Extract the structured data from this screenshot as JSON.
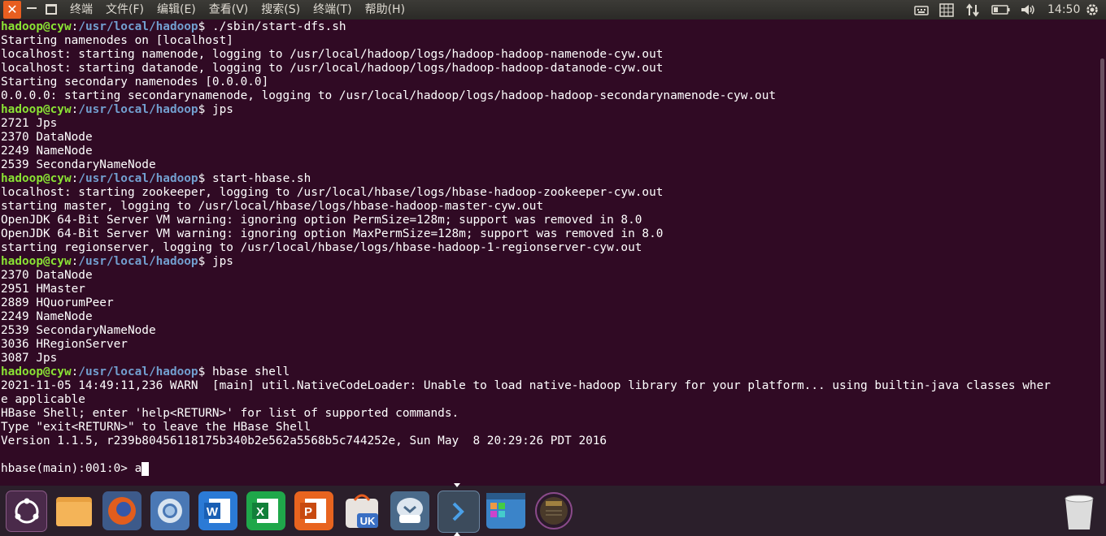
{
  "menubar": {
    "items": [
      "终端",
      "文件(F)",
      "编辑(E)",
      "查看(V)",
      "搜索(S)",
      "终端(T)",
      "帮助(H)"
    ],
    "clock": "14:50"
  },
  "prompt": {
    "user": "hadoop@cyw",
    "path": "/usr/local/hadoop",
    "suffix": "$ "
  },
  "terminal_lines": [
    {
      "type": "prompt",
      "cmd": "./sbin/start-dfs.sh"
    },
    {
      "type": "out",
      "text": "Starting namenodes on [localhost]"
    },
    {
      "type": "out",
      "text": "localhost: starting namenode, logging to /usr/local/hadoop/logs/hadoop-hadoop-namenode-cyw.out"
    },
    {
      "type": "out",
      "text": "localhost: starting datanode, logging to /usr/local/hadoop/logs/hadoop-hadoop-datanode-cyw.out"
    },
    {
      "type": "out",
      "text": "Starting secondary namenodes [0.0.0.0]"
    },
    {
      "type": "out",
      "text": "0.0.0.0: starting secondarynamenode, logging to /usr/local/hadoop/logs/hadoop-hadoop-secondarynamenode-cyw.out"
    },
    {
      "type": "prompt",
      "cmd": "jps"
    },
    {
      "type": "out",
      "text": "2721 Jps"
    },
    {
      "type": "out",
      "text": "2370 DataNode"
    },
    {
      "type": "out",
      "text": "2249 NameNode"
    },
    {
      "type": "out",
      "text": "2539 SecondaryNameNode"
    },
    {
      "type": "prompt",
      "cmd": "start-hbase.sh"
    },
    {
      "type": "out",
      "text": "localhost: starting zookeeper, logging to /usr/local/hbase/logs/hbase-hadoop-zookeeper-cyw.out"
    },
    {
      "type": "out",
      "text": "starting master, logging to /usr/local/hbase/logs/hbase-hadoop-master-cyw.out"
    },
    {
      "type": "out",
      "text": "OpenJDK 64-Bit Server VM warning: ignoring option PermSize=128m; support was removed in 8.0"
    },
    {
      "type": "out",
      "text": "OpenJDK 64-Bit Server VM warning: ignoring option MaxPermSize=128m; support was removed in 8.0"
    },
    {
      "type": "out",
      "text": "starting regionserver, logging to /usr/local/hbase/logs/hbase-hadoop-1-regionserver-cyw.out"
    },
    {
      "type": "prompt",
      "cmd": "jps"
    },
    {
      "type": "out",
      "text": "2370 DataNode"
    },
    {
      "type": "out",
      "text": "2951 HMaster"
    },
    {
      "type": "out",
      "text": "2889 HQuorumPeer"
    },
    {
      "type": "out",
      "text": "2249 NameNode"
    },
    {
      "type": "out",
      "text": "2539 SecondaryNameNode"
    },
    {
      "type": "out",
      "text": "3036 HRegionServer"
    },
    {
      "type": "out",
      "text": "3087 Jps"
    },
    {
      "type": "prompt",
      "cmd": "hbase shell"
    },
    {
      "type": "out",
      "text": "2021-11-05 14:49:11,236 WARN  [main] util.NativeCodeLoader: Unable to load native-hadoop library for your platform... using builtin-java classes wher"
    },
    {
      "type": "out",
      "text": "e applicable"
    },
    {
      "type": "out",
      "text": "HBase Shell; enter 'help<RETURN>' for list of supported commands."
    },
    {
      "type": "out",
      "text": "Type \"exit<RETURN>\" to leave the HBase Shell"
    },
    {
      "type": "out",
      "text": "Version 1.1.5, r239b80456118175b340b2e562a5568b5c744252e, Sun May  8 20:29:26 PDT 2016"
    },
    {
      "type": "out",
      "text": ""
    },
    {
      "type": "hbase",
      "text": "hbase(main):001:0> ",
      "input": "a"
    }
  ],
  "dock": {
    "items": [
      {
        "icon": "ubuntu-dash-icon",
        "color": "#7b3f74"
      },
      {
        "icon": "files-icon",
        "color": "#e8a040"
      },
      {
        "icon": "firefox-icon",
        "color": "#e25d1d"
      },
      {
        "icon": "chromium-icon",
        "color": "#4a78b5"
      },
      {
        "icon": "wps-writer-icon",
        "color": "#2b7ad6"
      },
      {
        "icon": "wps-spreadsheet-icon",
        "color": "#1fa74a"
      },
      {
        "icon": "wps-presentation-icon",
        "color": "#e8641f"
      },
      {
        "icon": "ubuntu-software-icon",
        "color": "#e8e3df"
      },
      {
        "icon": "software-updater-icon",
        "color": "#6d8fb0"
      },
      {
        "icon": "terminal-icon",
        "color": "#3a4a5a"
      },
      {
        "icon": "workspace-switcher-icon",
        "color": "#3b84c9"
      },
      {
        "icon": "disks-icon",
        "color": "#3a2a3a"
      }
    ],
    "uk_badge": "UK",
    "trash_icon": "trash-icon"
  },
  "colors": {
    "terminal_bg": "#300a24",
    "prompt_user": "#8ae234",
    "prompt_path": "#729fcf",
    "accent": "#e85e20"
  }
}
